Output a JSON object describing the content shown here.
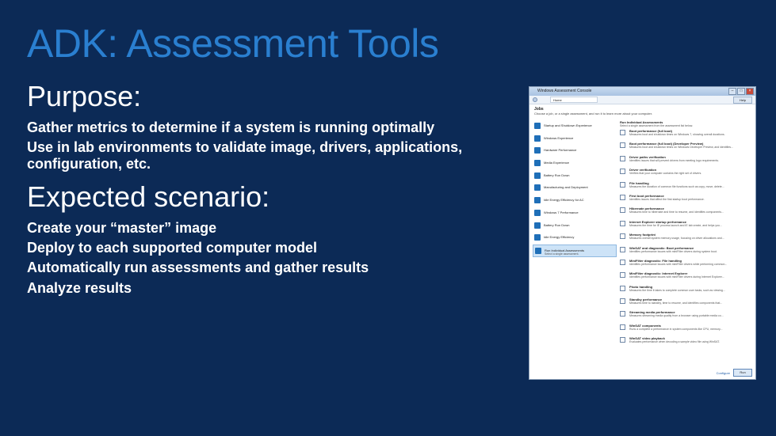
{
  "slide": {
    "title": "ADK: Assessment Tools",
    "purpose_heading": "Purpose:",
    "purpose_bullets": [
      "Gather metrics to determine if a system is running optimally",
      "Use in lab environments to validate image, drivers, applications, configuration, etc."
    ],
    "scenario_heading": "Expected scenario:",
    "scenario_bullets": [
      "Create your “master” image",
      "Deploy to each supported computer model",
      "Automatically run assessments and gather results",
      "Analyze results"
    ]
  },
  "window": {
    "title": "Windows Assessment Console",
    "tab_label": "Home",
    "help_label": "Help",
    "header_title": "Jobs",
    "header_sub": "Choose a job, or a single assessment, and run it to learn more about your computer.",
    "jobs": [
      {
        "label": "Startup and Shutdown Experience",
        "sub": ""
      },
      {
        "label": "Windows Experience",
        "sub": ""
      },
      {
        "label": "Hardware Performance",
        "sub": ""
      },
      {
        "label": "Media Experience",
        "sub": ""
      },
      {
        "label": "Battery Run Down",
        "sub": ""
      },
      {
        "label": "Manufacturing and Deployment",
        "sub": ""
      },
      {
        "label": "Idle Energy Efficiency for AC",
        "sub": ""
      },
      {
        "label": "Windows 7 Performance",
        "sub": ""
      },
      {
        "label": "Battery Run Down",
        "sub": ""
      },
      {
        "label": "Idle Energy Efficiency",
        "sub": ""
      },
      {
        "label": "Run Individual Assessments",
        "sub": "Select a single assessment."
      }
    ],
    "right_title": "Run Individual Assessments",
    "right_sub": "Select a single assessment from the assessment list below.",
    "assessments": [
      {
        "name": "Boot performance (full boot)",
        "desc": "Measures boot and shutdown times on Windows 7, showing overall durations."
      },
      {
        "name": "Boot performance (full boot) (Developer Preview)",
        "desc": "Measures boot and shutdown times on Windows Developer Preview, and identifies..."
      },
      {
        "name": "Driver paths verification",
        "desc": "Identifies issues that will prevent drivers from meeting logo requirements."
      },
      {
        "name": "Driver verification",
        "desc": "Verifies that your computer contains the right set of drivers."
      },
      {
        "name": "File handling",
        "desc": "Measures the duration of common file functions such as copy, move, delete..."
      },
      {
        "name": "First boot performance",
        "desc": "Identifies issues that affect the first startup boot performance."
      },
      {
        "name": "Hibernate performance",
        "desc": "Measures time to hibernate and time to resume, and identifies components..."
      },
      {
        "name": "Internet Explorer startup performance",
        "desc": "Measures the time for IE process launch and IE tab create, and helps you..."
      },
      {
        "name": "Memory footprint",
        "desc": "Measures overall system memory usage, focusing on driver allocations and..."
      },
      {
        "name": "WinSAT and diagnostic: Boot performance",
        "desc": "Identifies performance issues with miniFilter drivers during system boot."
      },
      {
        "name": "MiniFilter diagnostic: File handling",
        "desc": "Identifies performance issues with miniFilter drivers while performing common..."
      },
      {
        "name": "MiniFilter diagnostic: Internet Explorer",
        "desc": "Identifies performance issues with miniFilter drivers during Internet Explorer..."
      },
      {
        "name": "Photo handling",
        "desc": "Measures the time it takes to complete common user tasks, such as viewing..."
      },
      {
        "name": "Standby performance",
        "desc": "Measures time to standby, time to resume, and identifies components that..."
      },
      {
        "name": "Streaming media performance",
        "desc": "Measures streaming media quality from a browser using portable media co..."
      },
      {
        "name": "WinSAT components",
        "desc": "Runs a complete a performance in system components like CPU, memory..."
      },
      {
        "name": "WinSAT video playback",
        "desc": "Evaluates performance when decoding a sample video file using WinSAT."
      }
    ],
    "configure_label": "Configure",
    "run_label": "Run"
  }
}
